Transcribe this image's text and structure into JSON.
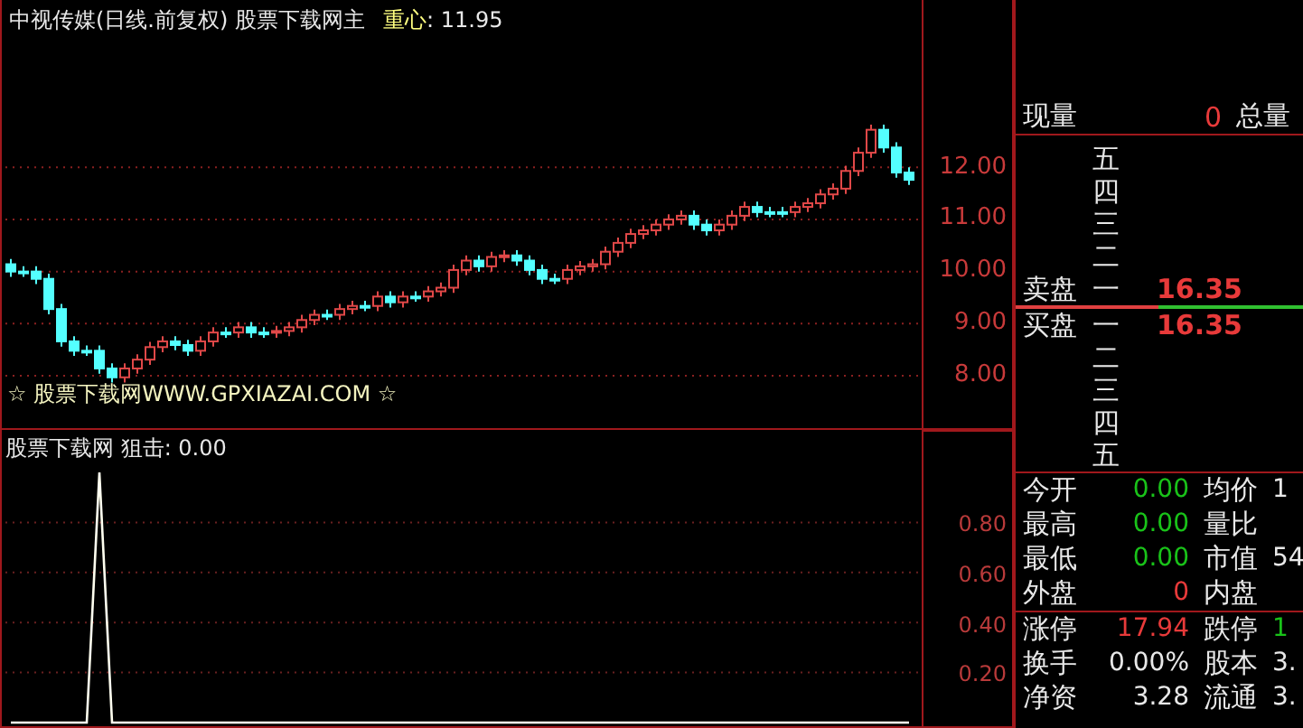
{
  "title": {
    "security": "中视传媒(日线.前复权) 股票下载网主",
    "indicator_label": "重心",
    "indicator_value": ": 11.95"
  },
  "price_chart": {
    "chart_data": {
      "type": "candlestick",
      "grid": true,
      "ylim": [
        7.03,
        15.21
      ],
      "yticks": [
        {
          "value": 12,
          "label": "12.00"
        },
        {
          "value": 11,
          "label": "11.00"
        },
        {
          "value": 10,
          "label": "10.00"
        },
        {
          "value": 9,
          "label": "9.00"
        },
        {
          "value": 8,
          "label": "8.00"
        }
      ],
      "ohlc": [
        [
          10.14,
          10.24,
          9.9,
          10.0
        ],
        [
          10.0,
          10.1,
          9.9,
          10.0
        ],
        [
          10.0,
          10.1,
          9.76,
          9.86
        ],
        [
          9.86,
          9.96,
          9.18,
          9.28
        ],
        [
          9.28,
          9.38,
          8.56,
          8.66
        ],
        [
          8.66,
          8.76,
          8.38,
          8.48
        ],
        [
          8.48,
          8.58,
          8.38,
          8.48
        ],
        [
          8.48,
          8.58,
          8.04,
          8.14
        ],
        [
          8.14,
          8.24,
          7.87,
          7.97
        ],
        [
          7.97,
          8.24,
          7.87,
          8.14
        ],
        [
          8.14,
          8.41,
          8.04,
          8.31
        ],
        [
          8.31,
          8.65,
          8.21,
          8.55
        ],
        [
          8.55,
          8.76,
          8.45,
          8.66
        ],
        [
          8.66,
          8.76,
          8.49,
          8.59
        ],
        [
          8.59,
          8.69,
          8.38,
          8.48
        ],
        [
          8.48,
          8.76,
          8.38,
          8.66
        ],
        [
          8.66,
          8.93,
          8.56,
          8.83
        ],
        [
          8.83,
          8.93,
          8.73,
          8.83
        ],
        [
          8.83,
          9.03,
          8.73,
          8.93
        ],
        [
          8.93,
          9.03,
          8.73,
          8.83
        ],
        [
          8.83,
          8.93,
          8.73,
          8.83
        ],
        [
          8.83,
          8.96,
          8.73,
          8.86
        ],
        [
          8.86,
          9.03,
          8.76,
          8.93
        ],
        [
          8.93,
          9.17,
          8.83,
          9.07
        ],
        [
          9.07,
          9.27,
          8.97,
          9.17
        ],
        [
          9.17,
          9.27,
          9.07,
          9.17
        ],
        [
          9.17,
          9.38,
          9.07,
          9.28
        ],
        [
          9.28,
          9.44,
          9.18,
          9.34
        ],
        [
          9.34,
          9.44,
          9.24,
          9.34
        ],
        [
          9.34,
          9.62,
          9.24,
          9.52
        ],
        [
          9.52,
          9.62,
          9.31,
          9.41
        ],
        [
          9.41,
          9.62,
          9.31,
          9.52
        ],
        [
          9.52,
          9.62,
          9.42,
          9.52
        ],
        [
          9.52,
          9.72,
          9.42,
          9.62
        ],
        [
          9.62,
          9.79,
          9.52,
          9.69
        ],
        [
          9.69,
          10.13,
          9.59,
          10.03
        ],
        [
          10.03,
          10.31,
          9.93,
          10.21
        ],
        [
          10.21,
          10.31,
          10.0,
          10.1
        ],
        [
          10.1,
          10.38,
          10.0,
          10.28
        ],
        [
          10.28,
          10.41,
          10.18,
          10.31
        ],
        [
          10.31,
          10.41,
          10.11,
          10.21
        ],
        [
          10.21,
          10.31,
          9.93,
          10.03
        ],
        [
          10.03,
          10.13,
          9.76,
          9.86
        ],
        [
          9.86,
          9.96,
          9.76,
          9.86
        ],
        [
          9.86,
          10.13,
          9.76,
          10.03
        ],
        [
          10.03,
          10.2,
          9.93,
          10.1
        ],
        [
          10.1,
          10.24,
          10.0,
          10.14
        ],
        [
          10.14,
          10.48,
          10.04,
          10.38
        ],
        [
          10.38,
          10.65,
          10.28,
          10.55
        ],
        [
          10.55,
          10.82,
          10.45,
          10.72
        ],
        [
          10.72,
          10.89,
          10.62,
          10.79
        ],
        [
          10.79,
          11.0,
          10.69,
          10.9
        ],
        [
          10.9,
          11.1,
          10.8,
          11.0
        ],
        [
          11.0,
          11.17,
          10.9,
          11.07
        ],
        [
          11.07,
          11.17,
          10.8,
          10.9
        ],
        [
          10.9,
          11.0,
          10.69,
          10.79
        ],
        [
          10.79,
          11.0,
          10.69,
          10.9
        ],
        [
          10.9,
          11.17,
          10.8,
          11.07
        ],
        [
          11.07,
          11.34,
          10.97,
          11.24
        ],
        [
          11.24,
          11.34,
          11.04,
          11.14
        ],
        [
          11.14,
          11.24,
          11.04,
          11.14
        ],
        [
          11.14,
          11.24,
          11.04,
          11.14
        ],
        [
          11.14,
          11.34,
          11.04,
          11.24
        ],
        [
          11.24,
          11.41,
          11.14,
          11.31
        ],
        [
          11.31,
          11.58,
          11.21,
          11.48
        ],
        [
          11.48,
          11.69,
          11.38,
          11.59
        ],
        [
          11.59,
          12.03,
          11.49,
          11.93
        ],
        [
          11.93,
          12.38,
          11.83,
          12.28
        ],
        [
          12.28,
          12.82,
          12.18,
          12.72
        ],
        [
          12.72,
          12.82,
          12.28,
          12.38
        ],
        [
          12.38,
          12.48,
          11.8,
          11.9
        ],
        [
          11.9,
          12.0,
          11.66,
          11.76
        ]
      ]
    }
  },
  "overlay_text": "☆ 股票下载网WWW.GPXIAZAI.COM ☆",
  "indicator_panel": {
    "title": "股票下载网 狙击: 0.00",
    "chart_data": {
      "type": "line",
      "series": [
        {
          "color": "#fffff0",
          "values": [
            0,
            0,
            0,
            0,
            0,
            0,
            0,
            1,
            0,
            0,
            0,
            0,
            0,
            0,
            0,
            0,
            0,
            0,
            0,
            0,
            0,
            0,
            0,
            0,
            0,
            0,
            0,
            0,
            0,
            0,
            0,
            0,
            0,
            0,
            0,
            0,
            0,
            0,
            0,
            0,
            0,
            0,
            0,
            0,
            0,
            0,
            0,
            0,
            0,
            0,
            0,
            0,
            0,
            0,
            0,
            0,
            0,
            0,
            0,
            0,
            0,
            0,
            0,
            0,
            0,
            0,
            0,
            0,
            0,
            0,
            0,
            0
          ]
        }
      ],
      "grid": true,
      "ylim": [
        0,
        1.17
      ],
      "yticks": [
        {
          "value": 0.8,
          "label": "0.80"
        },
        {
          "value": 0.6,
          "label": "0.60"
        },
        {
          "value": 0.4,
          "label": "0.40"
        },
        {
          "value": 0.2,
          "label": "0.20"
        }
      ]
    }
  },
  "order_book": {
    "volume_row": {
      "label": "现量",
      "value": "0",
      "label2": "总量"
    },
    "asks": [
      {
        "rank": "五"
      },
      {
        "rank": "四"
      },
      {
        "rank": "三"
      },
      {
        "rank": "二"
      },
      {
        "rank": "一",
        "side": "卖盘",
        "price": "16.35"
      }
    ],
    "bids": [
      {
        "rank": "一",
        "side": "买盘",
        "price": "16.35"
      },
      {
        "rank": "二"
      },
      {
        "rank": "三"
      },
      {
        "rank": "四"
      },
      {
        "rank": "五"
      }
    ]
  },
  "stats": [
    [
      {
        "cells": [
          {
            "label": "今开",
            "value": "0.00",
            "color": "#19c219"
          },
          {
            "label": "均价",
            "value": "1",
            "color": "#e8e8e8"
          }
        ]
      },
      {
        "cells": [
          {
            "label": "最高",
            "value": "0.00",
            "color": "#19c219"
          },
          {
            "label": "量比"
          }
        ]
      },
      {
        "cells": [
          {
            "label": "最低",
            "value": "0.00",
            "color": "#19c219"
          },
          {
            "label": "市值",
            "value": "54",
            "color": "#e8e8e8"
          }
        ]
      },
      {
        "cells": [
          {
            "label": "外盘",
            "value": "0",
            "color": "#e83a3a"
          },
          {
            "label": "内盘"
          }
        ]
      }
    ],
    [
      {
        "cells": [
          {
            "label": "涨停",
            "value": "17.94",
            "color": "#e83a3a"
          },
          {
            "label": "跌停",
            "value": "1",
            "color": "#19c219"
          }
        ]
      },
      {
        "cells": [
          {
            "label": "换手",
            "value": "0.00%",
            "color": "#e8e8e8"
          },
          {
            "label": "股本",
            "value": "3.",
            "color": "#e8e8e8"
          }
        ]
      },
      {
        "cells": [
          {
            "label": "净资",
            "value": "3.28",
            "color": "#e8e8e8"
          },
          {
            "label": "流通",
            "value": "3.",
            "color": "#e8e8e8"
          }
        ]
      }
    ]
  ]
}
